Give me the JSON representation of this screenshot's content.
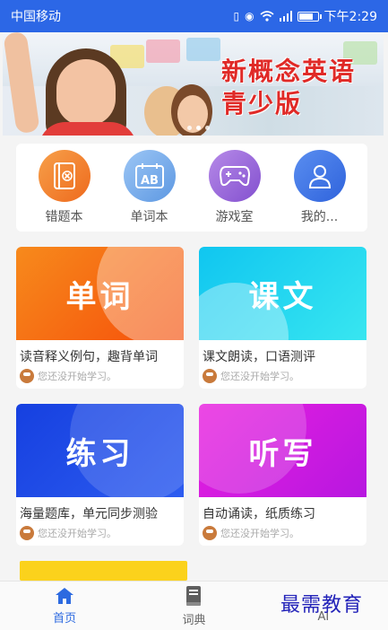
{
  "status_bar": {
    "carrier": "中国移动",
    "time": "下午2:29"
  },
  "banner": {
    "title_line1": "新概念英语",
    "title_line2": "青少版"
  },
  "quick_menu": [
    {
      "label": "错题本",
      "icon": "wrong-book-icon",
      "color": "#f17a2b"
    },
    {
      "label": "单词本",
      "icon": "word-book-icon",
      "color": "#6aa4e6"
    },
    {
      "label": "游戏室",
      "icon": "gamepad-icon",
      "color": "#8f5bd6"
    },
    {
      "label": "我的...",
      "icon": "user-icon",
      "color": "#3b72e8"
    }
  ],
  "courses": [
    {
      "title": "单词",
      "desc": "读音释义例句，趣背单词",
      "status": "您还没开始学习。",
      "color": "#f96a0c"
    },
    {
      "title": "课文",
      "desc": "课文朗读，口语测评",
      "status": "您还没开始学习。",
      "color": "#1fd4f1"
    },
    {
      "title": "练习",
      "desc": "海量题库，单元同步测验",
      "status": "您还没开始学习。",
      "color": "#1f49e5"
    },
    {
      "title": "听写",
      "desc": "自动诵读，纸质练习",
      "status": "您还没开始学习。",
      "color": "#dc1fdf"
    }
  ],
  "bottom_nav": [
    {
      "label": "首页",
      "icon": "home-icon",
      "active": true
    },
    {
      "label": "词典",
      "icon": "book-icon",
      "active": false
    },
    {
      "label": "AI",
      "icon": "ai-icon",
      "active": false
    }
  ],
  "watermark": "最需教育"
}
